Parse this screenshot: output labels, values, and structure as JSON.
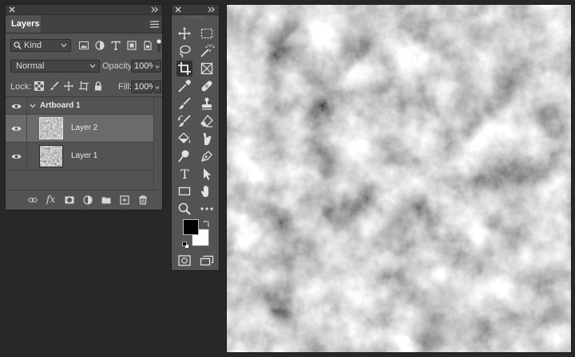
{
  "layers_panel": {
    "tab_label": "Layers",
    "filter_kind": "Kind",
    "filter_icons": [
      "image-filter-icon",
      "adjustment-filter-icon",
      "type-filter-icon",
      "shape-filter-icon",
      "smart-object-filter-icon"
    ],
    "blend_mode": "Normal",
    "opacity_label": "Opacity:",
    "opacity_value": "100%",
    "lock_label": "Lock:",
    "fill_label": "Fill:",
    "fill_value": "100%",
    "layers": [
      {
        "name": "Artboard 1",
        "type": "artboard",
        "visible": true,
        "selected": false
      },
      {
        "name": "Layer 2",
        "type": "pixel",
        "visible": true,
        "selected": true
      },
      {
        "name": "Layer 1",
        "type": "pixel",
        "visible": true,
        "selected": false
      }
    ],
    "footer_icons": [
      "link-layers-icon",
      "fx-icon",
      "add-mask-icon",
      "adjustment-layer-icon",
      "new-group-icon",
      "new-layer-icon",
      "delete-layer-icon"
    ],
    "fx_text": "fx"
  },
  "tools_panel": {
    "tools": [
      "move-tool-icon",
      "marquee-tool-icon",
      "lasso-tool-icon",
      "magic-wand-tool-icon",
      "crop-tool-icon",
      "frame-tool-icon",
      "eyedropper-tool-icon",
      "healing-brush-tool-icon",
      "brush-tool-icon",
      "clone-stamp-tool-icon",
      "history-brush-tool-icon",
      "eraser-tool-icon",
      "paint-bucket-tool-icon",
      "smudge-tool-icon",
      "dodge-tool-icon",
      "pen-tool-icon",
      "type-tool-icon",
      "path-selection-tool-icon",
      "rectangle-tool-icon",
      "hand-tool-icon",
      "zoom-tool-icon",
      "more-tools-icon"
    ],
    "active_tool": "crop-tool-icon",
    "type_tool_glyph": "T",
    "foreground_color": "#000000",
    "background_color": "#ffffff"
  },
  "canvas": {
    "content": "clouds-noise-render"
  }
}
